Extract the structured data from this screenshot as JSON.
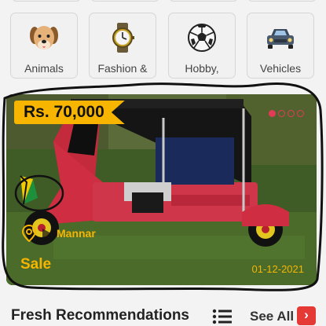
{
  "categories": [
    {
      "label": "Animals",
      "icon": "dog-icon"
    },
    {
      "label": "Fashion &",
      "icon": "watch-icon"
    },
    {
      "label": "Hobby,",
      "icon": "soccer-ball-icon"
    },
    {
      "label": "Vehicles",
      "icon": "car-icon"
    }
  ],
  "listing": {
    "price": "Rs. 70,000",
    "location": "Mannar",
    "type": "Sale",
    "date": "01-12-2021",
    "image_slides": 4,
    "active_slide": 1
  },
  "section": {
    "title": "Fresh Recommendations",
    "see_all": "See All",
    "see_all_icon": "chevron-right-icon",
    "view_toggle_icon": "list-view-icon"
  },
  "colors": {
    "accent_yellow": "#f7b500",
    "accent_red": "#e53935",
    "card_bg": "#3e5a25"
  }
}
